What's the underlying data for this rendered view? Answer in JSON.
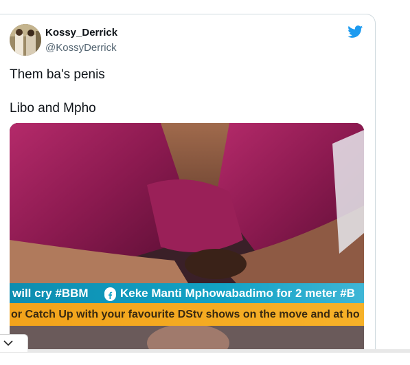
{
  "tweet": {
    "display_name": "Kossy_Derrick",
    "handle": "@KossyDerrick",
    "lines": [
      "Them ba's penis",
      "Libo and Mpho"
    ],
    "brand_icon": "twitter-bird-icon",
    "brand_color": "#1d9bf0"
  },
  "media": {
    "ticker_primary_left": "will cry #BBM",
    "ticker_primary_right": "Keke Manti  Mphowabadimo for 2 meter #B",
    "ticker_secondary": "or Catch Up with your favourite DStv shows on the move and at ho",
    "ticker_icon": "facebook-icon"
  },
  "ui": {
    "scroll_toggle_icon": "chevron-down-icon"
  }
}
